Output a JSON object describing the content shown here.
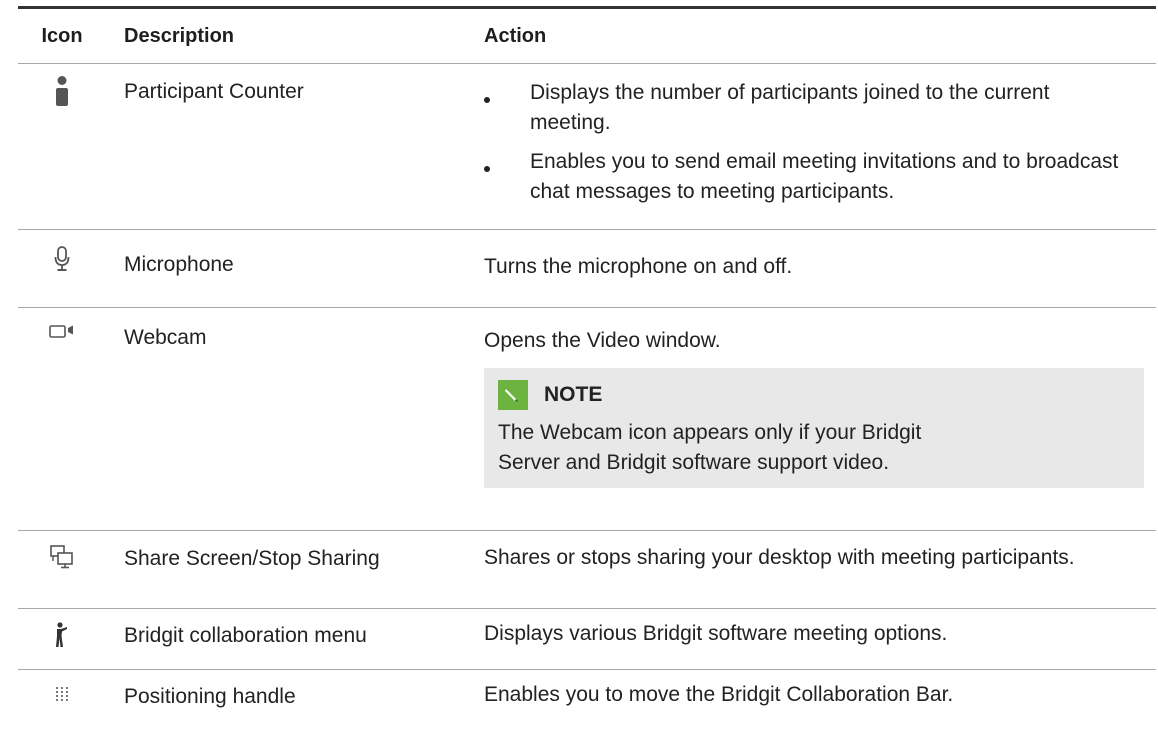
{
  "table": {
    "headers": {
      "icon": "Icon",
      "description": "Description",
      "action": "Action"
    },
    "rows": [
      {
        "icon": "participant-icon",
        "description": "Participant Counter",
        "bullets": [
          "Displays the number of participants joined to the current meeting.",
          "Enables you to send email meeting invitations and to broadcast chat messages to meeting participants."
        ]
      },
      {
        "icon": "microphone-icon",
        "description": "Microphone",
        "action": "Turns the microphone on and off."
      },
      {
        "icon": "webcam-icon",
        "description": "Webcam",
        "action": "Opens the Video window.",
        "note": {
          "title": "NOTE",
          "text": "The Webcam icon appears only if your Bridgit Server and Bridgit software support video."
        }
      },
      {
        "icon": "share-screen-icon",
        "description": "Share Screen/Stop Sharing",
        "action": "Shares or stops sharing your desktop with meeting participants."
      },
      {
        "icon": "collaboration-menu-icon",
        "description": "Bridgit collaboration menu",
        "action": "Displays various Bridgit software meeting options."
      },
      {
        "icon": "positioning-handle-icon",
        "description": "Positioning handle",
        "action": "Enables you to move the Bridgit Collaboration Bar."
      }
    ]
  },
  "colors": {
    "note_background": "#e8e8e8",
    "note_badge": "#6cb33f",
    "rule": "#a8a8a8",
    "top_rule": "#333333"
  }
}
